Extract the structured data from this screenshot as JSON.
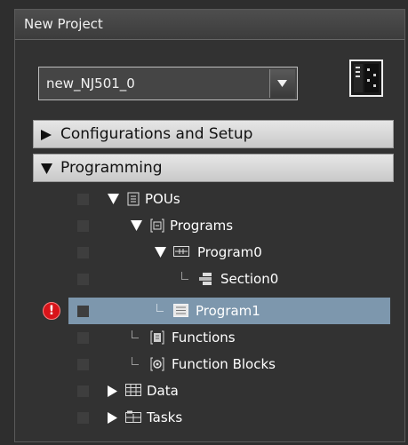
{
  "window": {
    "title": "New Project"
  },
  "controller": {
    "selected": "new_NJ501_0"
  },
  "sections": [
    {
      "label": "Configurations and Setup",
      "expanded": false
    },
    {
      "label": "Programming",
      "expanded": true
    }
  ],
  "tree": [
    {
      "label": "POUs",
      "icon": "pou-icon",
      "expanded": true
    },
    {
      "label": "Programs",
      "icon": "programs-folder-icon",
      "expanded": true
    },
    {
      "label": "Program0",
      "icon": "ladder-program-icon",
      "expanded": true
    },
    {
      "label": "Section0",
      "icon": "section-icon"
    },
    {
      "label": "Program1",
      "icon": "st-program-icon",
      "selected": true,
      "error": true,
      "error_symbol": "!"
    },
    {
      "label": "Functions",
      "icon": "functions-icon"
    },
    {
      "label": "Function Blocks",
      "icon": "function-blocks-icon"
    },
    {
      "label": "Data",
      "icon": "data-table-icon",
      "expanded": false
    },
    {
      "label": "Tasks",
      "icon": "tasks-icon",
      "expanded": false
    }
  ],
  "colors": {
    "selection": "#7d97ad",
    "error": "#d8141a",
    "panel": "#323232"
  }
}
